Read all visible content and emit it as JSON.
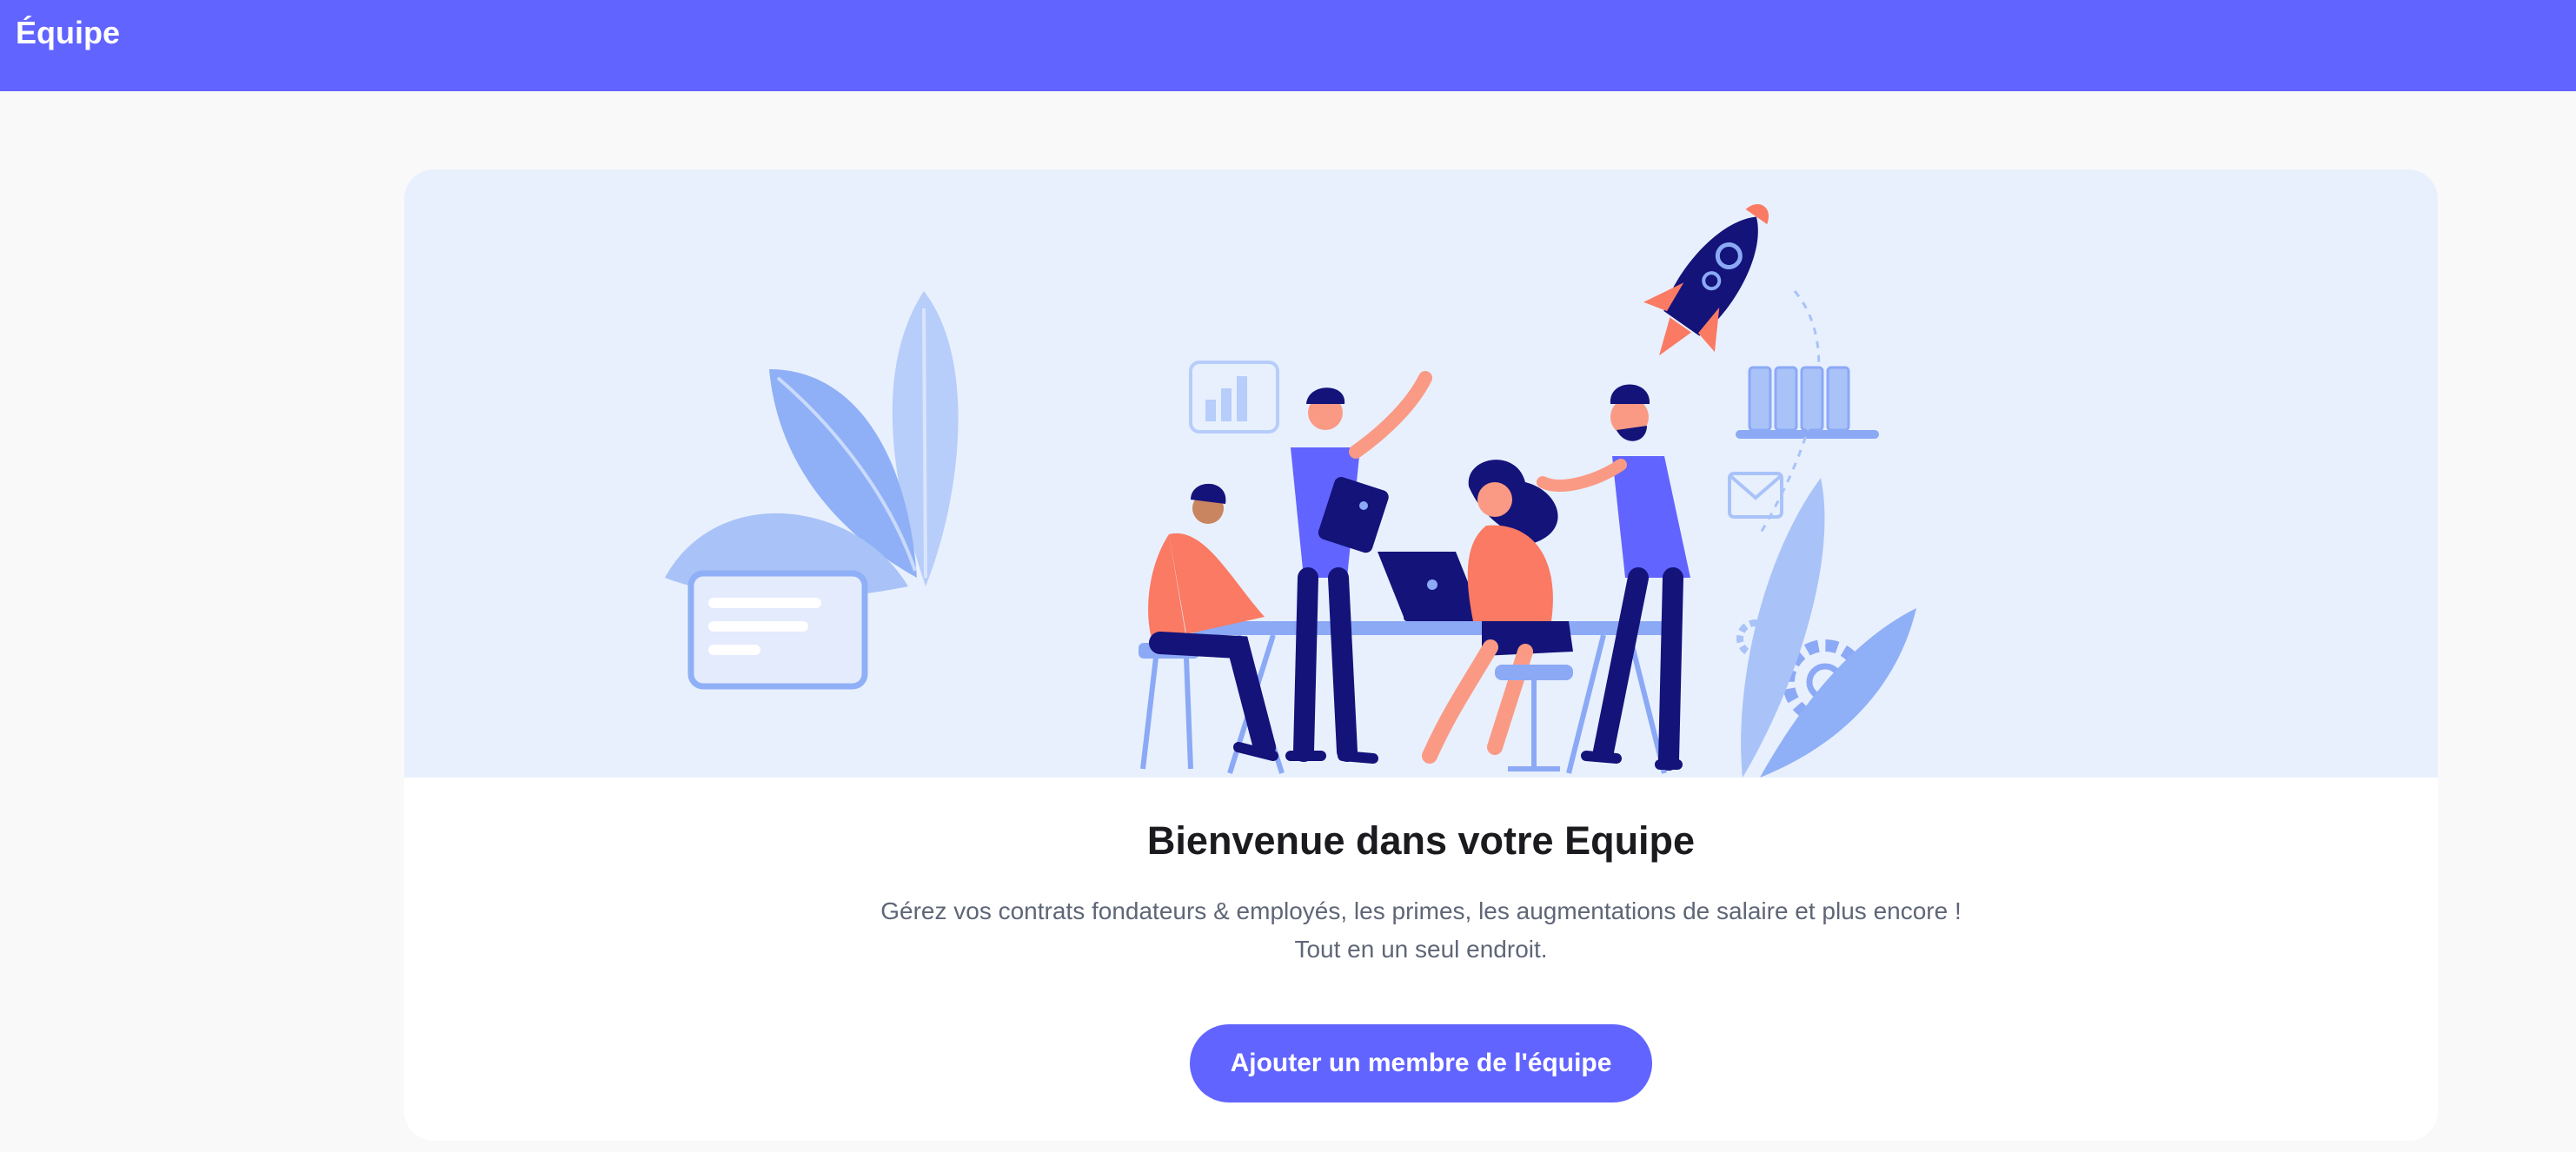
{
  "header": {
    "title": "Équipe"
  },
  "welcome": {
    "heading": "Bienvenue dans votre Equipe",
    "description_line1": "Gérez vos contrats fondateurs & employés, les primes, les augmentations de salaire et plus encore !",
    "description_line2": "Tout en un seul endroit.",
    "add_member_button": "Ajouter un membre de l'équipe"
  },
  "illustration": {
    "subject": "team-collaboration-illustration"
  },
  "colors": {
    "brand": "#6164ff",
    "page_bg": "#f9f9f9",
    "hero_bg": "#e8f0fe",
    "heading": "#1b1b1f",
    "text_muted": "#5f6677",
    "accent_coral": "#fa7a63",
    "navy": "#14137a"
  }
}
